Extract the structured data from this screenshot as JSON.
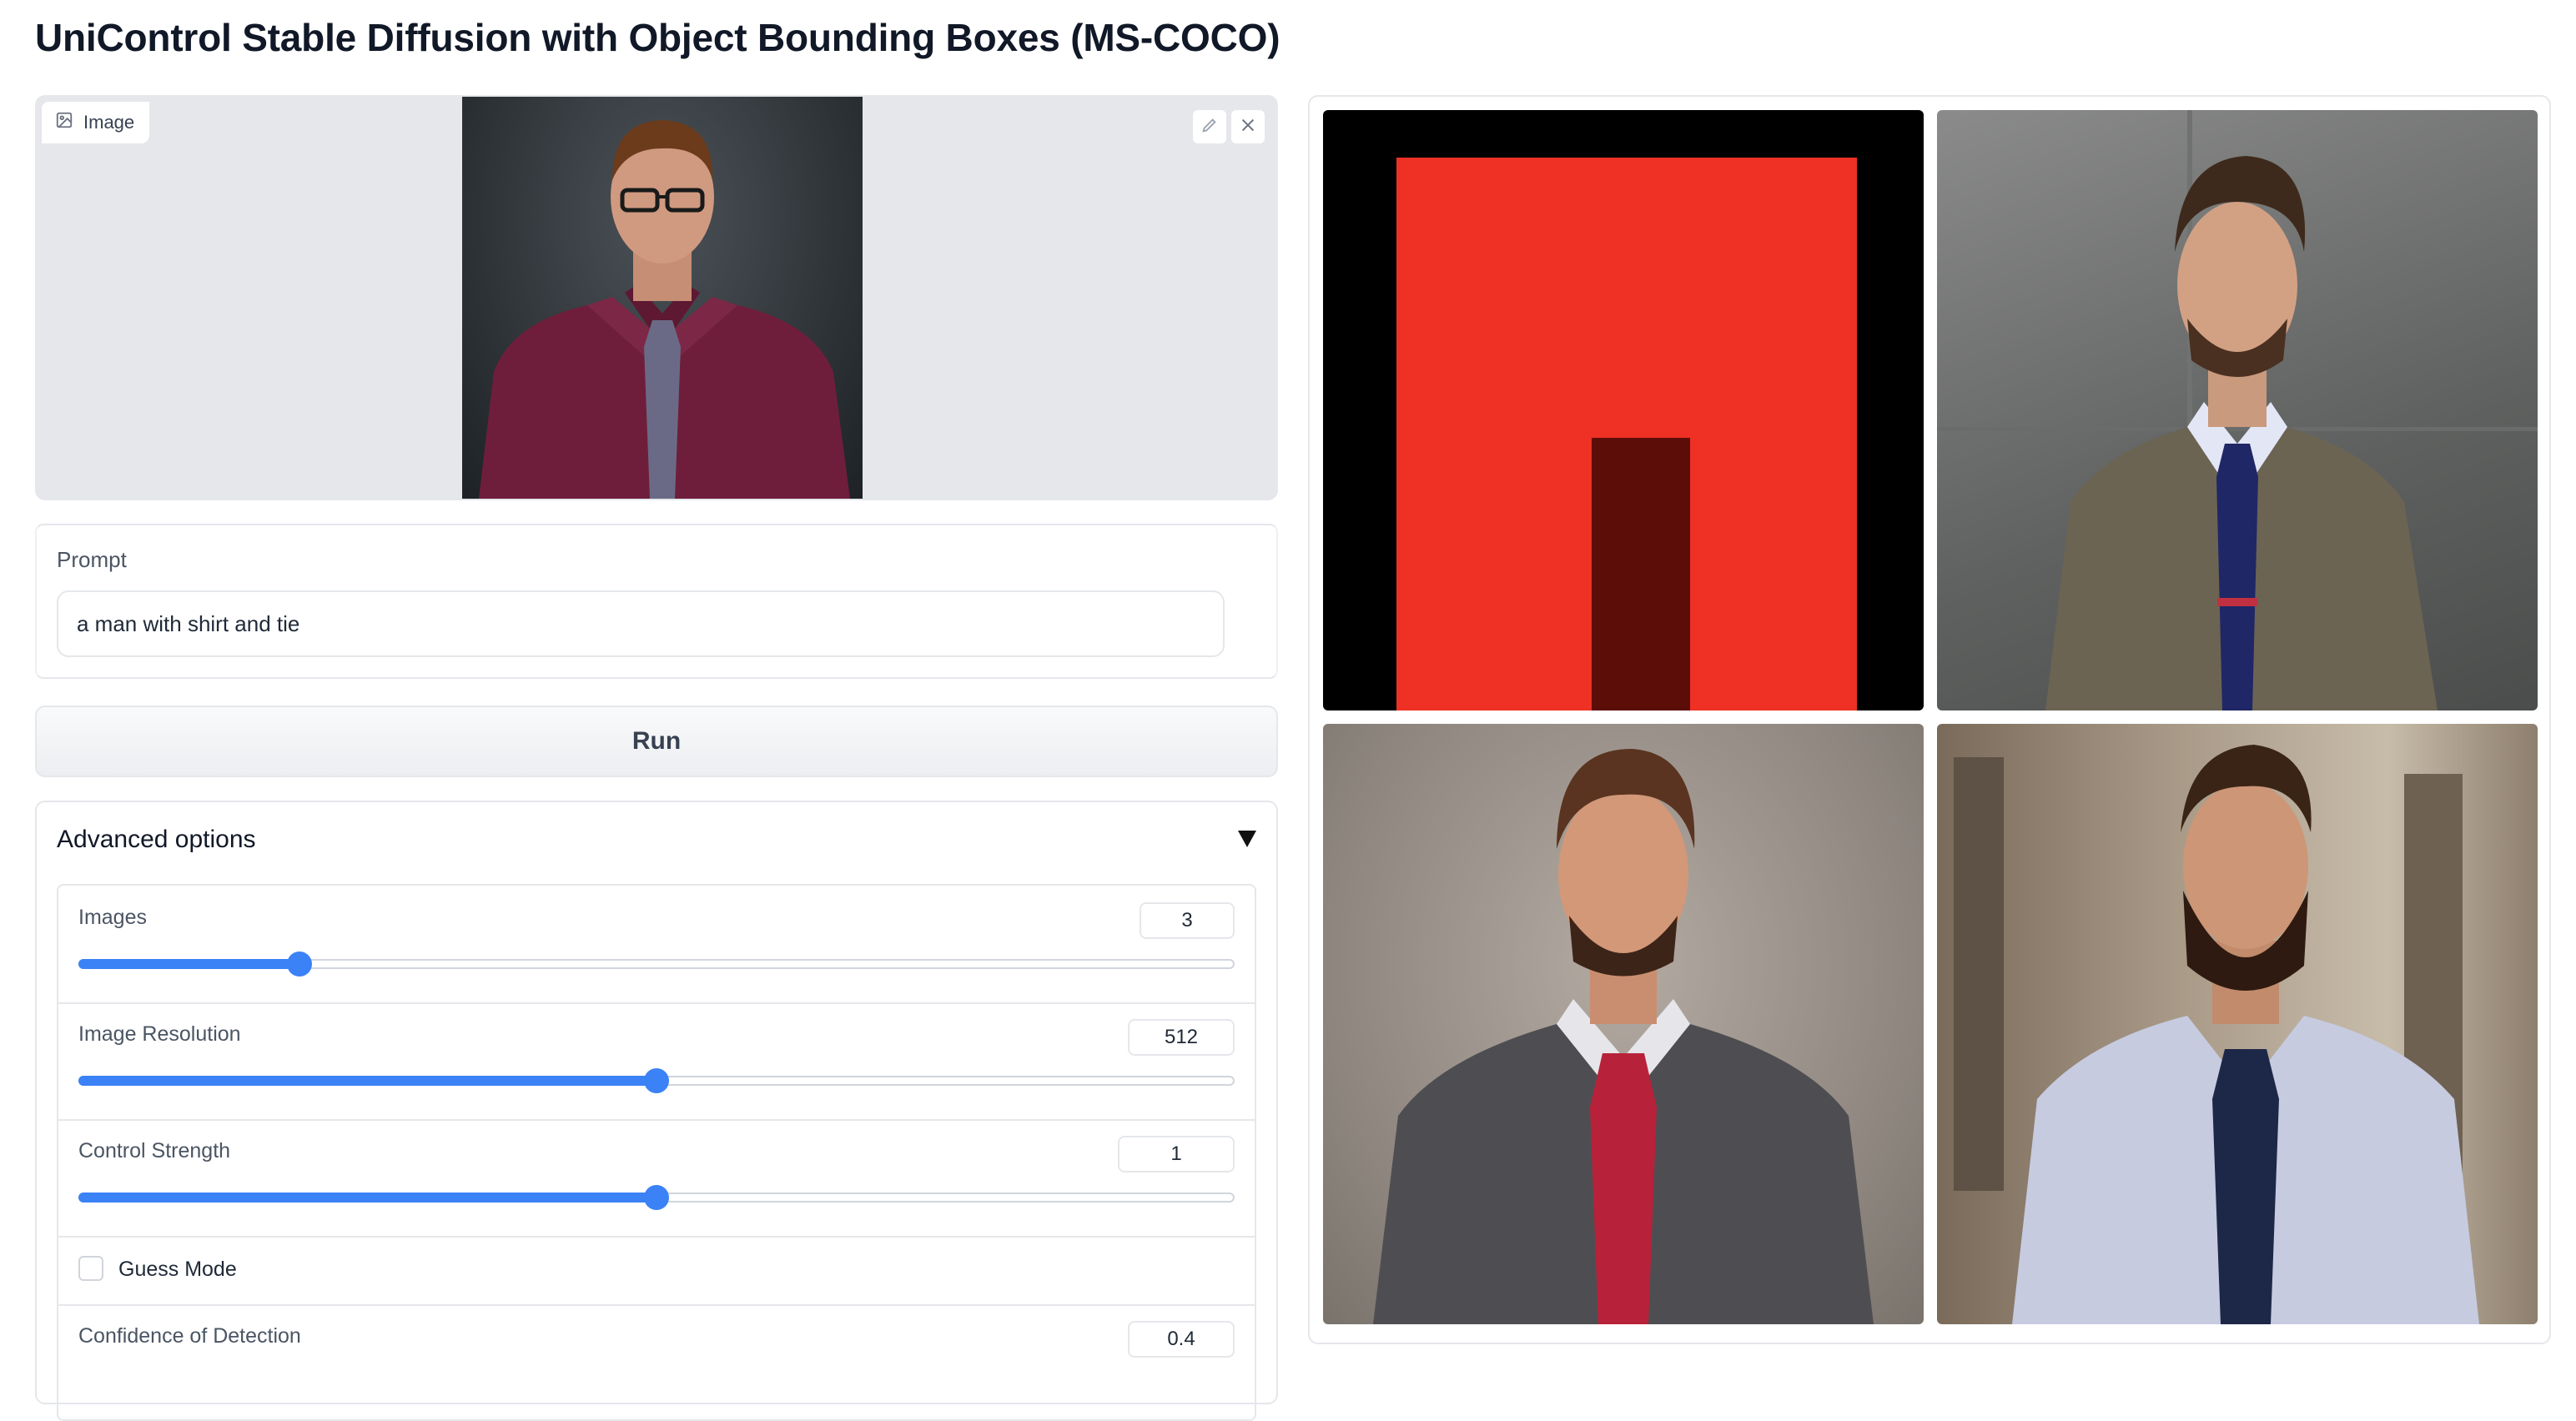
{
  "app": {
    "title": "UniControl Stable Diffusion with Object Bounding Boxes (MS-COCO)"
  },
  "image_input": {
    "label": "Image",
    "edit_icon": "pencil-icon",
    "clear_icon": "close-icon"
  },
  "prompt": {
    "label": "Prompt",
    "value": "a man with shirt and tie"
  },
  "run": {
    "label": "Run"
  },
  "advanced": {
    "title": "Advanced options",
    "images": {
      "label": "Images",
      "value": "3",
      "fraction": 0.19
    },
    "resolution": {
      "label": "Image Resolution",
      "value": "512",
      "fraction": 0.5
    },
    "strength": {
      "label": "Control Strength",
      "value": "1",
      "fraction": 0.5
    },
    "guess_mode": {
      "label": "Guess Mode",
      "checked": false
    },
    "confidence": {
      "label": "Confidence of Detection",
      "value": "0.4"
    }
  },
  "colors": {
    "accent": "#3b82f6",
    "bbox_red": "#ee3124",
    "bbox_dark": "#5c0d08"
  }
}
